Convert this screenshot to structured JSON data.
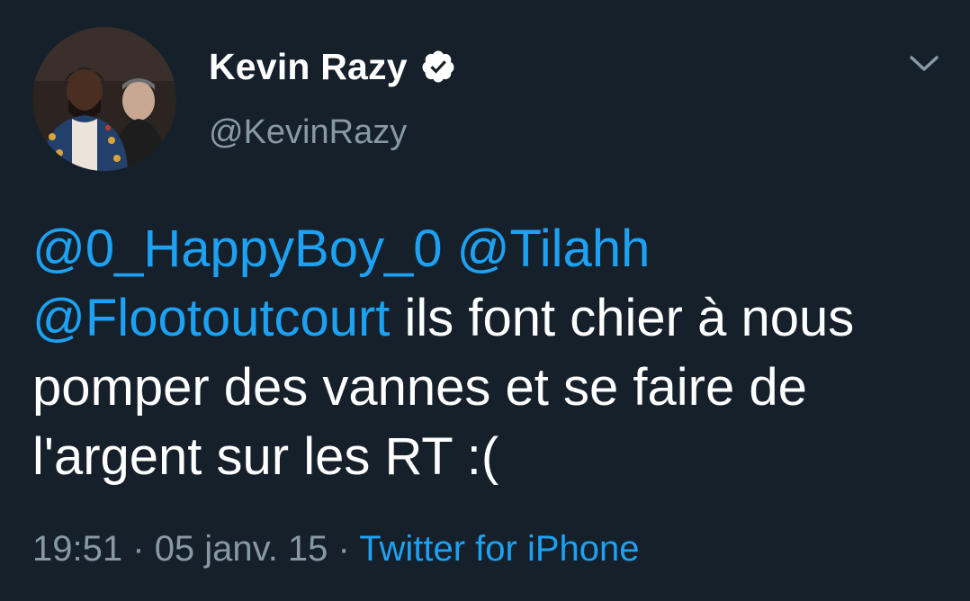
{
  "user": {
    "display_name": "Kevin Razy",
    "handle": "@KevinRazy",
    "verified_icon": "verified-badge-icon",
    "avatar_icon": "profile-photo"
  },
  "menu": {
    "icon": "chevron-down-icon"
  },
  "tweet": {
    "mentions": [
      "@0_HappyBoy_0",
      "@Tilahh",
      "@Flootoutcourt"
    ],
    "text": "ils font chier à nous pomper des vannes et se faire de l'argent sur les RT :("
  },
  "meta": {
    "time": "19:51",
    "date": "05 janv. 15",
    "separator": "·",
    "source": "Twitter for iPhone"
  },
  "colors": {
    "background": "#15202b",
    "text": "#ffffff",
    "secondary": "#8899a6",
    "link": "#1da1f2"
  }
}
